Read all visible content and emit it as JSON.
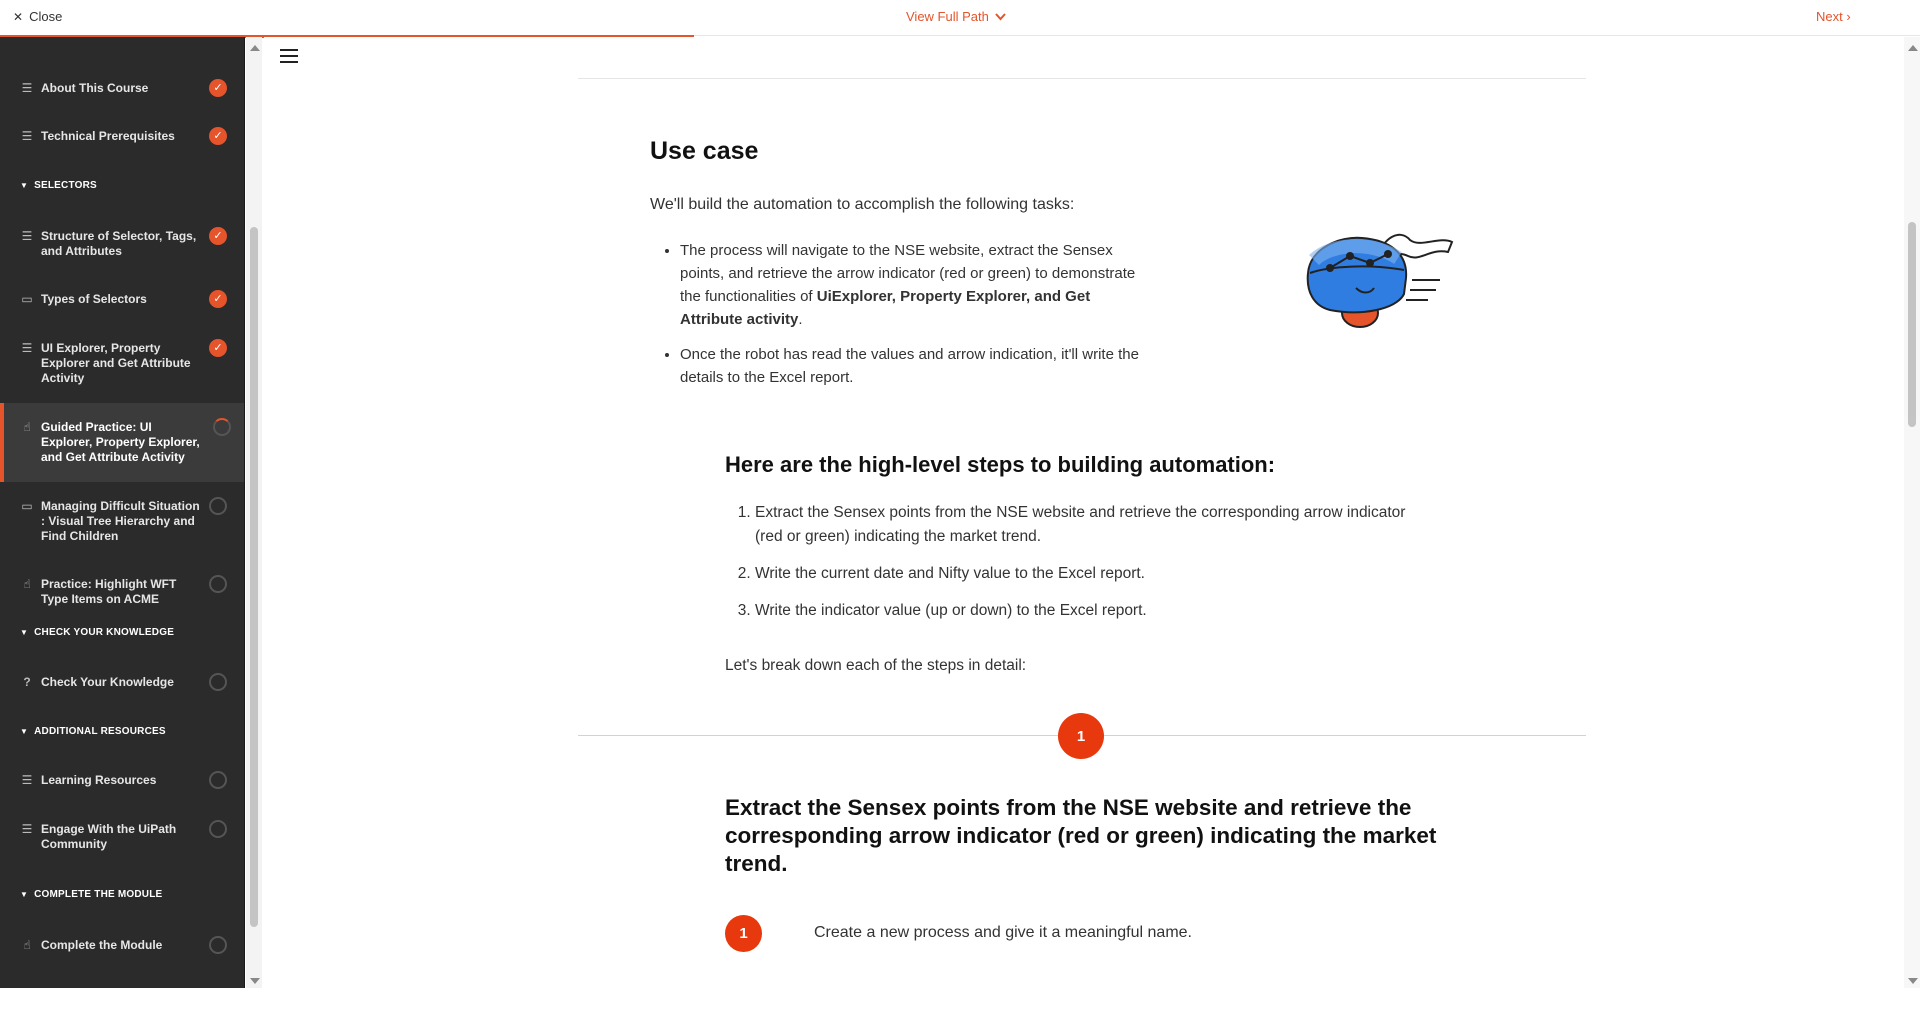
{
  "topbar": {
    "close_label": "Close",
    "full_path_label": "View Full Path",
    "next_label": "Next ›"
  },
  "sidebar": {
    "items": [
      {
        "label": "About This Course",
        "icon": "lines-icon",
        "status": "done"
      },
      {
        "label": "Technical Prerequisites",
        "icon": "lines-icon",
        "status": "done"
      },
      {
        "label": "Structure of Selector, Tags, and Attributes",
        "icon": "lines-icon",
        "status": "done"
      },
      {
        "label": "Types of Selectors",
        "icon": "video-icon",
        "status": "done"
      },
      {
        "label": "UI Explorer, Property Explorer and Get Attribute Activity",
        "icon": "lines-icon",
        "status": "done"
      },
      {
        "label": "Guided Practice: UI Explorer, Property Explorer, and Get Attribute Activity",
        "icon": "hand-icon",
        "status": "in-progress"
      },
      {
        "label": "Managing Difficult Situation : Visual Tree Hierarchy and Find Children",
        "icon": "video-icon",
        "status": "empty"
      },
      {
        "label": "Practice: Highlight WFT Type Items on ACME",
        "icon": "hand-icon",
        "status": "empty"
      },
      {
        "label": "Check Your Knowledge",
        "icon": "quiz-icon",
        "status": "empty"
      },
      {
        "label": "Learning Resources",
        "icon": "lines-icon",
        "status": "empty"
      },
      {
        "label": "Engage With the UiPath Community",
        "icon": "lines-icon",
        "status": "empty"
      },
      {
        "label": "Complete the Module",
        "icon": "hand-icon",
        "status": "empty"
      }
    ],
    "sections": [
      "SELECTORS",
      "CHECK YOUR KNOWLEDGE",
      "ADDITIONAL RESOURCES",
      "COMPLETE THE MODULE"
    ]
  },
  "content": {
    "usecase_heading": "Use case",
    "intro": "We'll build the automation to accomplish the following tasks:",
    "bullet1_a": "The process will navigate to the NSE website, extract the Sensex points, and retrieve the arrow indicator (red or green) to demonstrate the functionalities of ",
    "bullet1_b": "UiExplorer, Property Explorer, and Get Attribute activity",
    "bullet1_c": ".",
    "bullet2": "Once the robot has read the values and arrow indication, it'll write the details to the Excel report.",
    "steps_heading": "Here are the high-level steps to building automation:",
    "steps": [
      "Extract the Sensex points from the NSE website and retrieve the corresponding arrow indicator (red or green) indicating the market trend.",
      "Write the current date and Nifty value to the Excel report.",
      "Write the indicator value (up or down) to the Excel report."
    ],
    "breakdown": "Let's break down each of the steps in detail:",
    "step_number": "1",
    "extract_heading": "Extract the Sensex points from the NSE website and retrieve the corresponding arrow indicator (red or green) indicating the market trend.",
    "substep_number": "1",
    "substep_text": "Create a new process and give it a meaningful name."
  },
  "colors": {
    "accent": "#e5542b",
    "sidebar_bg": "#2b2b2b"
  }
}
